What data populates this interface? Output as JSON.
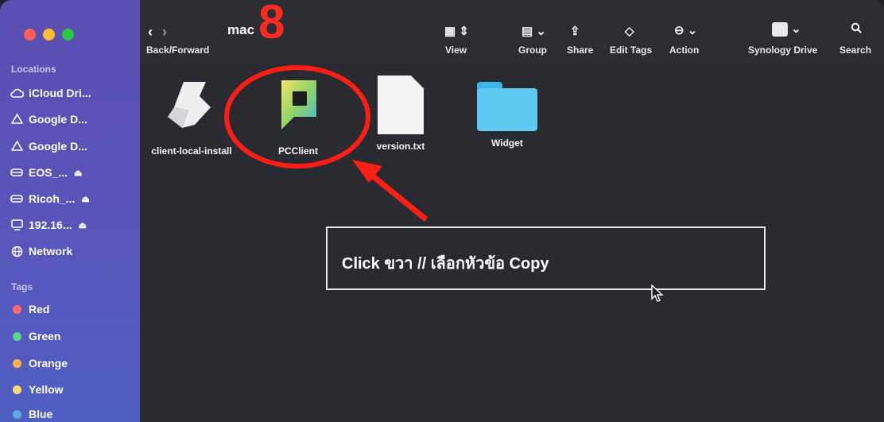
{
  "window": {
    "folder_title": "mac"
  },
  "toolbar": {
    "back_forward_label": "Back/Forward",
    "view_label": "View",
    "group_label": "Group",
    "share_label": "Share",
    "edit_tags_label": "Edit Tags",
    "action_label": "Action",
    "synology_label": "Synology Drive",
    "search_label": "Search"
  },
  "sidebar": {
    "locations_heading": "Locations",
    "locations": [
      {
        "label": "iCloud Dri...",
        "icon": "cloud-icon"
      },
      {
        "label": "Google D...",
        "icon": "google-drive-icon"
      },
      {
        "label": "Google D...",
        "icon": "google-drive-icon"
      },
      {
        "label": "EOS_...",
        "icon": "drive-icon"
      },
      {
        "label": "Ricoh_...",
        "icon": "drive-icon"
      },
      {
        "label": "192.16...",
        "icon": "display-icon"
      },
      {
        "label": "Network",
        "icon": "globe-icon"
      }
    ],
    "tags_heading": "Tags",
    "tags": [
      {
        "label": "Red",
        "color": "#ff6b6b"
      },
      {
        "label": "Green",
        "color": "#58d68d"
      },
      {
        "label": "Orange",
        "color": "#ffb347"
      },
      {
        "label": "Yellow",
        "color": "#f7dc6f"
      },
      {
        "label": "Blue",
        "color": "#5dade2"
      }
    ]
  },
  "files": [
    {
      "name": "client-local-install",
      "icon": "script-icon"
    },
    {
      "name": "PCClient",
      "icon": "pcclient-app-icon"
    },
    {
      "name": "version.txt",
      "icon": "text-file-icon"
    },
    {
      "name": "Widget",
      "icon": "folder-icon"
    }
  ],
  "annotation": {
    "step_number": "8",
    "instruction": "Click ขวา // เลือกหัวข้อ Copy",
    "annotation_color": "#ff1e14"
  }
}
